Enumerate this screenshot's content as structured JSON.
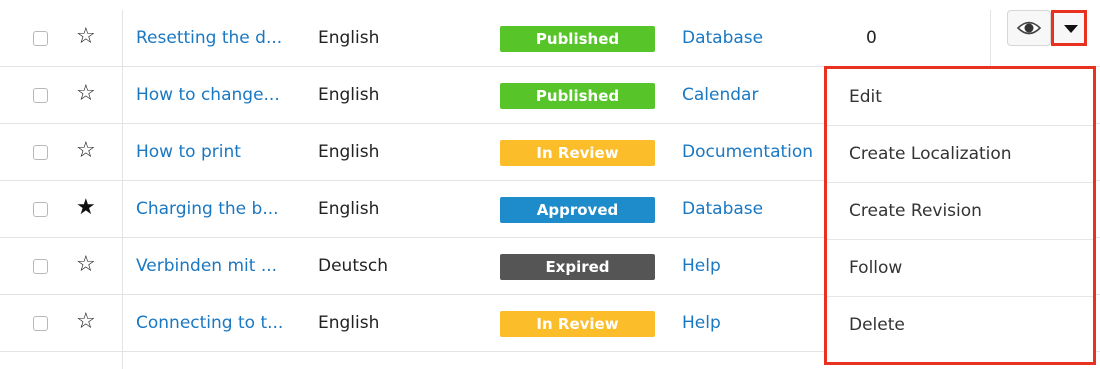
{
  "colors": {
    "link": "#1a78c2",
    "highlight": "#e8321f",
    "published": "#57c52a",
    "in_review": "#fbbd2a",
    "approved": "#1e8ccb",
    "expired": "#555555"
  },
  "rows": [
    {
      "name": "Resetting the d...",
      "language": "English",
      "status": "Published",
      "status_color": "#57c52a",
      "category": "Database",
      "views": "0",
      "starred": false
    },
    {
      "name": "How to change...",
      "language": "English",
      "status": "Published",
      "status_color": "#57c52a",
      "category": "Calendar",
      "views": "",
      "starred": false
    },
    {
      "name": "How to print",
      "language": "English",
      "status": "In Review",
      "status_color": "#fbbd2a",
      "category": "Documentation",
      "views": "",
      "starred": false
    },
    {
      "name": "Charging the b...",
      "language": "English",
      "status": "Approved",
      "status_color": "#1e8ccb",
      "category": "Database",
      "views": "",
      "starred": true
    },
    {
      "name": "Verbinden mit ...",
      "language": "Deutsch",
      "status": "Expired",
      "status_color": "#555555",
      "category": "Help",
      "views": "",
      "starred": false
    },
    {
      "name": "Connecting to t...",
      "language": "English",
      "status": "In Review",
      "status_color": "#fbbd2a",
      "category": "Help",
      "views": "",
      "starred": false
    }
  ],
  "action_icons": {
    "preview": "eye-icon",
    "dropdown": "caret-down-icon"
  },
  "menu": {
    "items": [
      "Edit",
      "Create Localization",
      "Create Revision",
      "Follow",
      "Delete"
    ]
  }
}
